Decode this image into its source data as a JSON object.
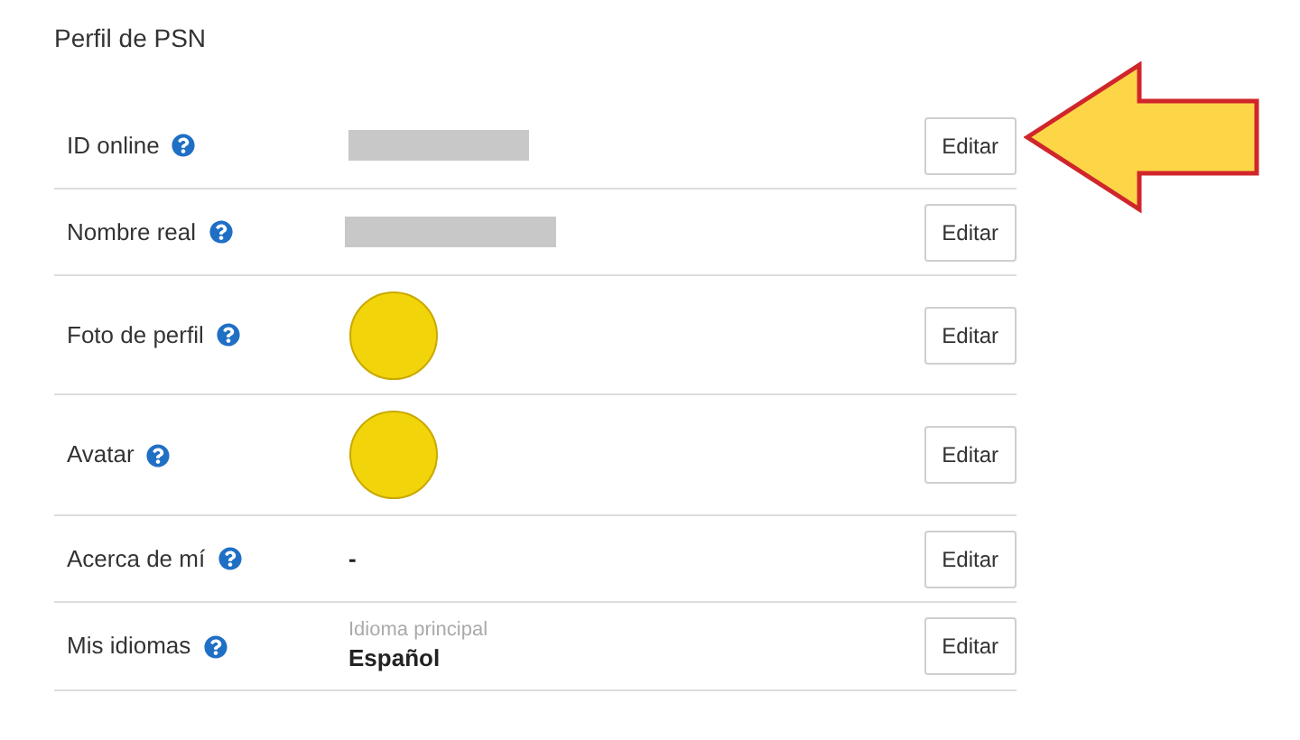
{
  "section_title": "Perfil de PSN",
  "rows": [
    {
      "label": "ID online",
      "kind": "redacted",
      "button": "Editar"
    },
    {
      "label": "Nombre real",
      "kind": "redacted",
      "button": "Editar"
    },
    {
      "label": "Foto de perfil",
      "kind": "avatar",
      "button": "Editar"
    },
    {
      "label": "Avatar",
      "kind": "avatar",
      "button": "Editar"
    },
    {
      "label": "Acerca de mí",
      "kind": "text",
      "value": "-",
      "button": "Editar"
    },
    {
      "label": "Mis idiomas",
      "kind": "language",
      "caption": "Idioma principal",
      "value": "Español",
      "button": "Editar"
    }
  ]
}
